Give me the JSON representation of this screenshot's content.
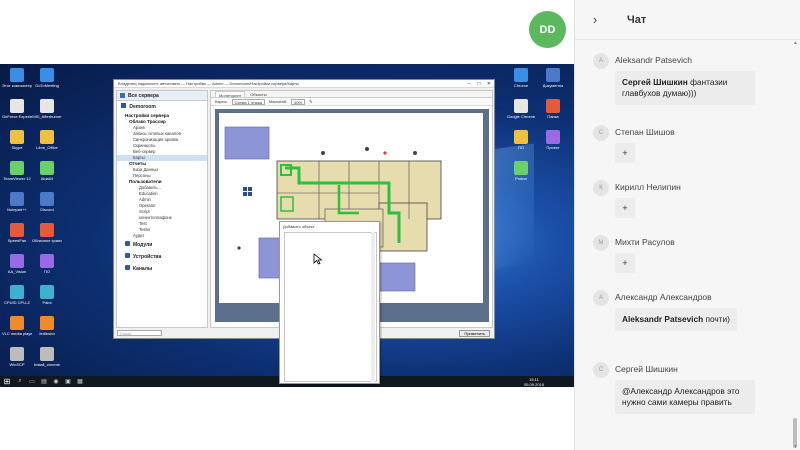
{
  "avatar": {
    "initials": "DD",
    "color": "#5cb85c"
  },
  "desktop": {
    "icons_left_col1": [
      "Этот компьютер",
      "GeForce Experience",
      "Skype",
      "TeamViewer 12",
      "Notepad++",
      "SpeedFan",
      "AA_Vision",
      "CPUID CPU-Z",
      "VLC media player",
      "WinSCP"
    ],
    "icons_left_col2": [
      "GoToMeeting",
      "MSI_Afterburner",
      "Libre_Office",
      "Aida64",
      "Discord",
      "Облачное хранилище",
      "ПО",
      "Paint",
      "Jedinstvo",
      "Install_chrome"
    ],
    "icons_right": [
      "Chrome",
      "Google Chrome",
      "ПО",
      "Proton",
      "Документы",
      "Папка",
      "Проект"
    ],
    "taskbar_clock": "15:11\n05.09.2018"
  },
  "app": {
    "title": "Владелец подключен: автономно — Настройки — Admin — Demoroom/Настройки сервера/Карты",
    "all_servers": "Все сервера",
    "server_name": "Demoroom",
    "tree": [
      {
        "label": "Настройки сервера",
        "kind": "bold"
      },
      {
        "label": "Облако Трассир",
        "kind": "sub-bold"
      },
      {
        "label": "Архив",
        "kind": "item"
      },
      {
        "label": "Запись сетевых каналов",
        "kind": "item"
      },
      {
        "label": "Синхронизация архива",
        "kind": "item"
      },
      {
        "label": "Скриншоты",
        "kind": "item"
      },
      {
        "label": "Веб-сервер",
        "kind": "item"
      },
      {
        "label": "Карты",
        "kind": "selected"
      },
      {
        "label": "Отчеты",
        "kind": "sub-bold"
      },
      {
        "label": "База Данных",
        "kind": "item"
      },
      {
        "label": "Персоны",
        "kind": "item"
      },
      {
        "label": "Пользователи",
        "kind": "sub-bold"
      },
      {
        "label": "Добавить...",
        "kind": "item2"
      },
      {
        "label": "Education",
        "kind": "item2"
      },
      {
        "label": "Admin",
        "kind": "item2"
      },
      {
        "label": "Operator",
        "kind": "item2"
      },
      {
        "label": "Script",
        "kind": "item2"
      },
      {
        "label": "клиентоплафоне",
        "kind": "item2"
      },
      {
        "label": "Test",
        "kind": "item2"
      },
      {
        "label": "Tester",
        "kind": "item2"
      },
      {
        "label": "Аудит",
        "kind": "item"
      }
    ],
    "sections": [
      "Модули",
      "Устройства",
      "Каналы"
    ],
    "tabs": [
      "Мониторинг",
      "Объекты"
    ],
    "toolbar": {
      "map_label": "Карты:",
      "map_value": "Схема 1 этажа",
      "scale_label": "Масштаб:",
      "scale_value": "50%"
    },
    "bottom_search": "Поиск",
    "buttons": [
      "Применить"
    ],
    "popup_title": "Добавить объект"
  },
  "chat": {
    "title": "Чат",
    "messages": [
      {
        "initial": "A",
        "name": "Aleksandr Patsevich",
        "mention": "Сергей Шишкин",
        "text": "фантазии главбухов думаю)))"
      },
      {
        "initial": "С",
        "name": "Степан Шишов",
        "text": "+"
      },
      {
        "initial": "К",
        "name": "Кирилл Нелипин",
        "text": "+"
      },
      {
        "initial": "М",
        "name": "Михти Расулов",
        "text": "+"
      },
      {
        "initial": "А",
        "name": "Александр Александров",
        "mention": "Aleksandr Patsevich",
        "text": "почти)"
      },
      {
        "initial": "С",
        "name": "Сергей Шишкин",
        "text": "@Александр Александров это нужно сами камеры править"
      }
    ]
  }
}
